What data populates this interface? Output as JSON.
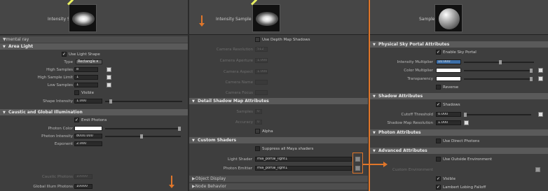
{
  "left": {
    "sample_label": "Intensity Sample",
    "sections": {
      "mental_ray": "mental ray",
      "area_light": "Area Light",
      "caustic": "Caustic and Global Illumination",
      "shape_intensity_label": "Shape Intensity"
    },
    "area_light": {
      "use_light_shape": "Use Light Shape",
      "type_label": "Type",
      "type_value": "Rectangle",
      "high_samples_label": "High Samples",
      "high_samples_value": "8",
      "high_sample_limit_label": "High Sample Limit",
      "high_sample_limit_value": "1",
      "low_samples_label": "Low Samples",
      "low_samples_value": "1",
      "visible_label": "Visible",
      "shape_intensity_value": "1.000"
    },
    "caustic": {
      "emit_photons": "Emit Photons",
      "photon_color_label": "Photon Color",
      "photon_intensity_label": "Photon Intensity",
      "photon_intensity_value": "8000.000",
      "exponent_label": "Exponent",
      "exponent_value": "2.000",
      "caustic_photons_label": "Caustic Photons",
      "caustic_photons_value": "10000",
      "global_illum_label": "Global Illum Photons",
      "global_illum_value": "10000"
    }
  },
  "middle": {
    "sample_label": "Intensity Sample",
    "top_option": "Use Depth Map Shadows",
    "camera": [
      {
        "label": "Camera Resolution",
        "value": "512"
      },
      {
        "label": "Camera Aperture",
        "value": "1.000"
      },
      {
        "label": "Camera Aspect",
        "value": "1.000"
      },
      {
        "label": "Camera Name",
        "value": ""
      },
      {
        "label": "Camera Focus",
        "value": ""
      }
    ],
    "detail_shadow_section": "Detail Shadow Map Attributes",
    "samples_label": "Samples",
    "samples_value": "0",
    "accuracy_label": "Accuracy",
    "accuracy_value": "0",
    "alpha_label": "Alpha",
    "custom_shaders_section": "Custom Shaders",
    "suppress_label": "Suppress all Maya shaders",
    "light_shader_label": "Light Shader",
    "light_shader_value": "mia_portal_light1",
    "photon_emitter_label": "Photon Emitter",
    "photon_emitter_value": "mia_portal_light1",
    "object_display": "Object Display",
    "node_behavior": "Node Behavior"
  },
  "right": {
    "sample_label": "Sample",
    "portal_section": "Physical Sky Portal Attributes",
    "enable_label": "Enable Sky Portal",
    "intensity_mult_label": "Intensity Multiplier",
    "intensity_mult_value": "10.000",
    "color_mult_label": "Color Multiplier",
    "transparency_label": "Transparency",
    "reverse_label": "Reverse",
    "shadow_section": "Shadow Attributes",
    "shadows_label": "Shadows",
    "cutoff_label": "Cutoff Threshold",
    "cutoff_value": "0.000",
    "shadow_res_label": "Shadow Map Resolution",
    "shadow_res_value": "1.000",
    "photon_section": "Photon Attributes",
    "use_direct_label": "Use Direct Photons",
    "advanced_section": "Advanced Attributes",
    "use_outside_label": "Use Outside Environment",
    "custom_env_label": "Custom Environment",
    "visible_label": "Visible",
    "lambert_label": "Lambert Lobing Falloff"
  },
  "colors": {
    "accent": "#e0762a"
  }
}
